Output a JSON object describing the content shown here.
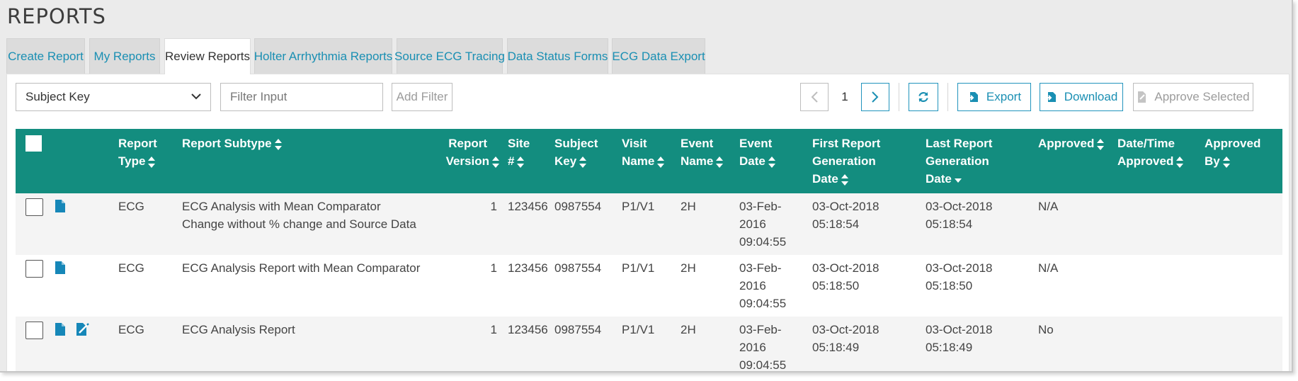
{
  "page": {
    "title": "REPORTS"
  },
  "tabs": [
    {
      "label": "Create Report"
    },
    {
      "label": "My Reports"
    },
    {
      "label": "Review Reports",
      "active": true
    },
    {
      "label": "Holter Arrhythmia Reports"
    },
    {
      "label": "Source ECG Tracing"
    },
    {
      "label": "Data Status Forms"
    },
    {
      "label": "ECG Data Export"
    }
  ],
  "toolbar": {
    "filter_field": "Subject Key",
    "filter_input_placeholder": "Filter Input",
    "add_filter_label": "Add Filter",
    "page_number": "1",
    "export_label": "Export",
    "download_label": "Download",
    "approve_selected_label": "Approve Selected"
  },
  "table": {
    "headers": {
      "report_type": [
        "Report",
        "Type"
      ],
      "report_subtype": [
        "Report Subtype"
      ],
      "report_version": [
        "Report",
        "Version"
      ],
      "site": [
        "Site",
        "#"
      ],
      "subject_key": [
        "Subject",
        "Key"
      ],
      "visit_name": [
        "Visit",
        "Name"
      ],
      "event_name": [
        "Event",
        "Name"
      ],
      "event_date": [
        "Event",
        "Date"
      ],
      "first_report": [
        "First Report",
        "Generation",
        "Date"
      ],
      "last_report": [
        "Last Report",
        "Generation",
        "Date"
      ],
      "approved": [
        "Approved"
      ],
      "datetime_approved": [
        "Date/Time",
        "Approved"
      ],
      "approved_by": [
        "Approved",
        "By"
      ]
    },
    "rows": [
      {
        "report_type": "ECG",
        "report_subtype": [
          "ECG Analysis with Mean Comparator",
          "Change without % change and Source Data"
        ],
        "report_version": "1",
        "site": "123456",
        "subject_key": "0987554",
        "visit_name": "P1/V1",
        "event_name": "2H",
        "event_date": [
          "03-Feb-",
          "2016",
          "09:04:55"
        ],
        "first_report": [
          "03-Oct-2018",
          "05:18:54"
        ],
        "last_report": [
          "03-Oct-2018",
          "05:18:54"
        ],
        "approved": "N/A",
        "icons": [
          "document-icon"
        ]
      },
      {
        "report_type": "ECG",
        "report_subtype": [
          "ECG Analysis Report with Mean Comparator"
        ],
        "report_version": "1",
        "site": "123456",
        "subject_key": "0987554",
        "visit_name": "P1/V1",
        "event_name": "2H",
        "event_date": [
          "03-Feb-",
          "2016",
          "09:04:55"
        ],
        "first_report": [
          "03-Oct-2018",
          "05:18:50"
        ],
        "last_report": [
          "03-Oct-2018",
          "05:18:50"
        ],
        "approved": "N/A",
        "icons": [
          "document-icon"
        ]
      },
      {
        "report_type": "ECG",
        "report_subtype": [
          "ECG Analysis Report"
        ],
        "report_version": "1",
        "site": "123456",
        "subject_key": "0987554",
        "visit_name": "P1/V1",
        "event_name": "2H",
        "event_date": [
          "03-Feb-",
          "2016",
          "09:04:55"
        ],
        "first_report": [
          "03-Oct-2018",
          "05:18:49"
        ],
        "last_report": [
          "03-Oct-2018",
          "05:18:49"
        ],
        "approved": "No",
        "icons": [
          "document-icon",
          "edit-document-icon"
        ]
      }
    ]
  },
  "colors": {
    "header_bg": "#138d7f",
    "link_blue": "#1a8fb3",
    "icon_blue": "#1687b8"
  }
}
